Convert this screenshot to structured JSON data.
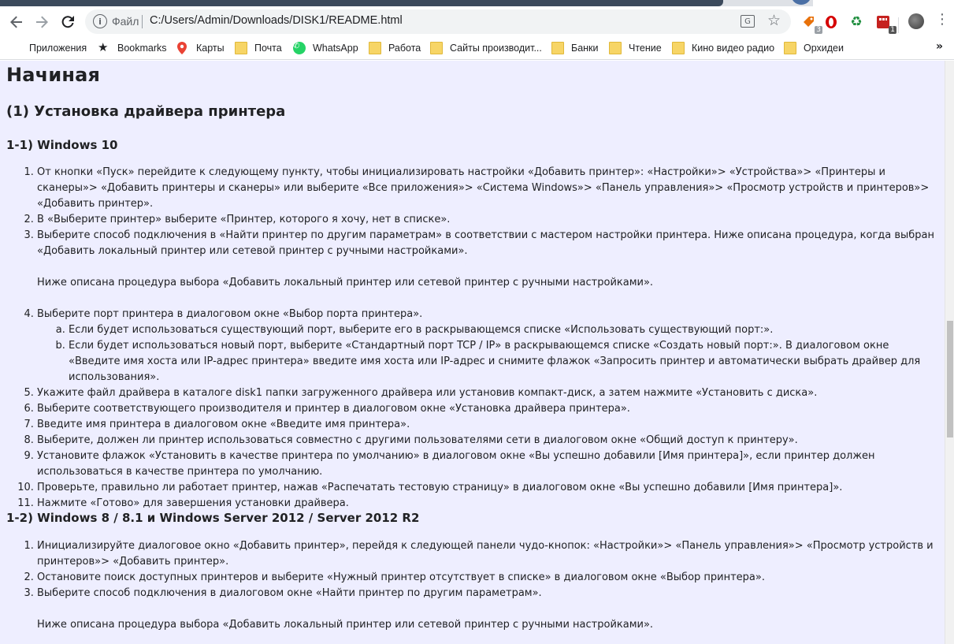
{
  "browser": {
    "omnibox": {
      "scheme_label": "Файл",
      "url": "C:/Users/Admin/Downloads/DISK1/README.html"
    },
    "extensions": [
      {
        "name": "tag-extension-icon",
        "badge": "3"
      },
      {
        "name": "opera-like-extension-icon",
        "badge": ""
      },
      {
        "name": "recycle-extension-icon",
        "badge": ""
      },
      {
        "name": "red-grid-extension-icon",
        "badge": "1"
      }
    ],
    "menu_glyph": "⋮"
  },
  "bookmarks": [
    {
      "label": "Приложения",
      "icon": "apps-grid-icon"
    },
    {
      "label": "Bookmarks",
      "icon": "star-icon"
    },
    {
      "label": "Карты",
      "icon": "map-pin-icon"
    },
    {
      "label": "Почта",
      "icon": "folder-icon"
    },
    {
      "label": "WhatsApp",
      "icon": "whatsapp-icon"
    },
    {
      "label": "Работа",
      "icon": "folder-icon"
    },
    {
      "label": "Сайты производит...",
      "icon": "folder-icon"
    },
    {
      "label": "Банки",
      "icon": "folder-icon"
    },
    {
      "label": "Чтение",
      "icon": "folder-icon"
    },
    {
      "label": "Кино видео радио",
      "icon": "folder-icon"
    },
    {
      "label": "Орхидеи",
      "icon": "folder-icon"
    }
  ],
  "bookmarks_more": "»",
  "page": {
    "title": "Начиная",
    "section1": {
      "heading": "(1) Установка драйвера принтера",
      "sub1": {
        "heading": "1-1) Windows 10",
        "steps": [
          "От кнопки «Пуск» перейдите к следующему пункту, чтобы инициализировать настройки «Добавить принтер»: «Настройки»> «Устройства»> «Принтеры и сканеры»> «Добавить принтеры и сканеры» или выберите «Все приложения»> «Система Windows»> «Панель управления»> «Просмотр устройств и принтеров»> «Добавить принтер».",
          "В «Выберите принтер» выберите «Принтер, которого я хочу, нет в списке».",
          "Выберите способ подключения в «Найти принтер по другим параметрам» в соответствии с мастером настройки принтера. Ниже описана процедура, когда выбран «Добавить локальный принтер или сетевой принтер с ручными настройками».",
          "Выберите порт принтера в диалоговом окне «Выбор порта принтера».",
          "Укажите файл драйвера в каталоге disk1 папки загруженного драйвера или установив компакт-диск, а затем нажмите «Установить с диска».",
          "Выберите соответствующего производителя и принтер в диалоговом окне «Установка драйвера принтера».",
          "Введите имя принтера в диалоговом окне «Введите имя принтера».",
          "Выберите, должен ли принтер использоваться совместно с другими пользователями сети в диалоговом окне «Общий доступ к принтеру».",
          "Установите флажок «Установить в качестве принтера по умолчанию» в диалоговом окне «Вы успешно добавили [Имя принтера]», если принтер должен использоваться в качестве принтера по умолчанию.",
          "Проверьте, правильно ли работает принтер, нажав «Распечатать тестовую страницу» в диалоговом окне «Вы успешно добавили [Имя принтера]».",
          "Нажмите «Готово» для завершения установки драйвера."
        ],
        "step3_note": "Ниже описана процедура выбора «Добавить локальный принтер или сетевой принтер с ручными настройками».",
        "step4_sub": [
          "Если будет использоваться существующий порт, выберите его в раскрывающемся списке «Использовать существующий порт:».",
          "Если будет использоваться новый порт, выберите «Стандартный порт TCP / IP» в раскрывающемся списке «Создать новый порт:». В диалоговом окне «Введите имя хоста или IP-адрес принтера» введите имя хоста или IP-адрес и снимите флажок «Запросить принтер и автоматически выбрать драйвер для использования»."
        ]
      },
      "sub2": {
        "heading": "1-2) Windows 8 / 8.1 и Windows Server 2012 / Server 2012 R2",
        "steps": [
          "Инициализируйте диалоговое окно «Добавить принтер», перейдя к следующей панели чудо-кнопок: «Настройки»> «Панель управления»> «Просмотр устройств и принтеров»> «Добавить принтер».",
          "Остановите поиск доступных принтеров и выберите «Нужный принтер отсутствует в списке» в диалоговом окне «Выбор принтера».",
          "Выберите способ подключения в диалоговом окне «Найти принтер по другим параметрам»."
        ],
        "step3_note": "Ниже описана процедура выбора «Добавить локальный принтер или сетевой принтер с ручными настройками»."
      }
    }
  }
}
